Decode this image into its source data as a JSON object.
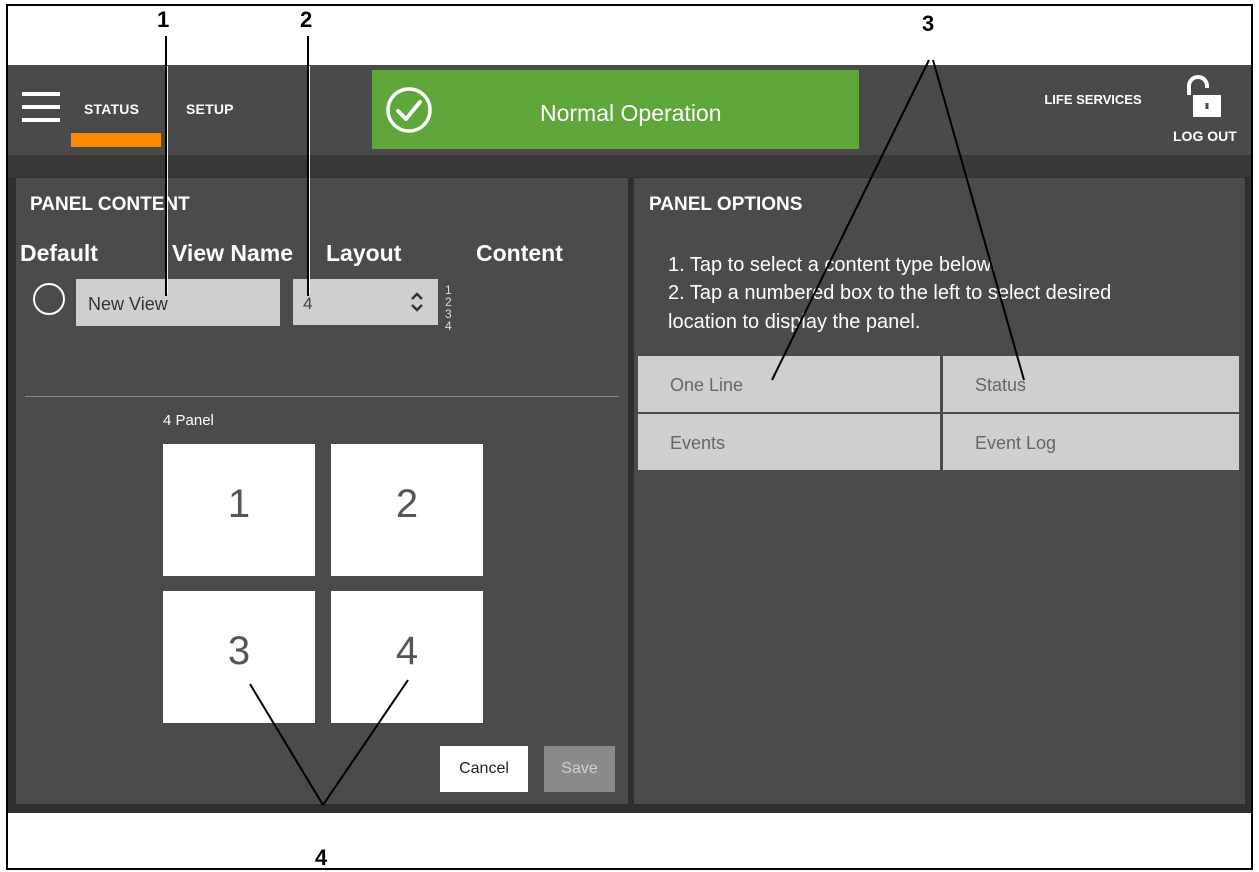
{
  "nav": {
    "tabs": [
      {
        "label": "STATUS",
        "active": true
      },
      {
        "label": "SETUP",
        "active": false
      }
    ],
    "status_banner": "Normal Operation",
    "life_services": "LIFE SERVICES",
    "logout": "LOG OUT",
    "accent_color": "#ff8c00",
    "status_color": "#5fa73a"
  },
  "panel_content": {
    "title": "PANEL CONTENT",
    "columns": {
      "default": "Default",
      "view_name": "View Name",
      "layout": "Layout",
      "content": "Content"
    },
    "view_name_value": "New View",
    "layout_value": "4",
    "content_numbers": [
      "1",
      "2",
      "3",
      "4"
    ],
    "panel_caption": "4 Panel",
    "cells": [
      "1",
      "2",
      "3",
      "4"
    ],
    "cancel": "Cancel",
    "save": "Save"
  },
  "panel_options": {
    "title": "PANEL OPTIONS",
    "instruction_1": "1. Tap to select a content type below.",
    "instruction_2": "2. Tap a numbered box to the left to select desired",
    "instruction_3": "location to display the panel.",
    "options": [
      "One Line",
      "Status",
      "Events",
      "Event Log"
    ]
  },
  "callouts": [
    "1",
    "2",
    "3",
    "4"
  ]
}
